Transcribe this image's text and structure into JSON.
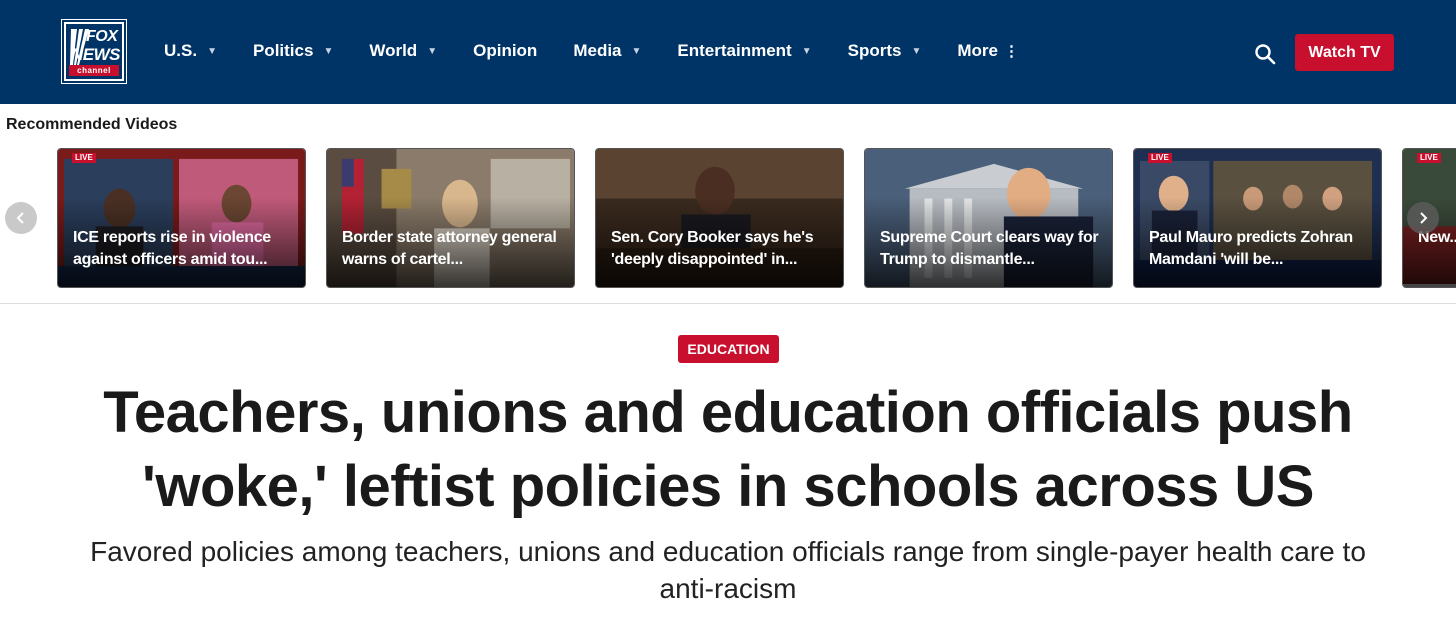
{
  "header": {
    "logo": {
      "top": "FOX",
      "bottom": "NEWS",
      "band": "channel"
    },
    "nav": [
      {
        "label": "U.S.",
        "has_caret": true
      },
      {
        "label": "Politics",
        "has_caret": true
      },
      {
        "label": "World",
        "has_caret": true
      },
      {
        "label": "Opinion",
        "has_caret": false
      },
      {
        "label": "Media",
        "has_caret": true
      },
      {
        "label": "Entertainment",
        "has_caret": true
      },
      {
        "label": "Sports",
        "has_caret": true
      },
      {
        "label": "More",
        "has_caret": false
      }
    ],
    "watch_label": "Watch TV",
    "colors": {
      "bar": "#003366",
      "accent": "#c8102e"
    }
  },
  "recommended": {
    "title": "Recommended Videos",
    "videos": [
      {
        "title": "ICE reports rise in violence against officers amid tou...",
        "live": "LIVE"
      },
      {
        "title": "Border state attorney general warns of cartel...",
        "live": ""
      },
      {
        "title": "Sen. Cory Booker says he's 'deeply disappointed' in...",
        "live": ""
      },
      {
        "title": "Supreme Court clears way for Trump to dismantle...",
        "live": ""
      },
      {
        "title": "Paul Mauro predicts Zohran Mamdani 'will be...",
        "live": "LIVE"
      },
      {
        "title": "New... Califo...",
        "live": "LIVE"
      }
    ]
  },
  "article": {
    "category": "EDUCATION",
    "headline": "Teachers, unions and education officials push 'woke,' leftist policies in schools across US",
    "subhead": "Favored policies among teachers, unions and education officials range from single-payer health care to anti-racism"
  }
}
